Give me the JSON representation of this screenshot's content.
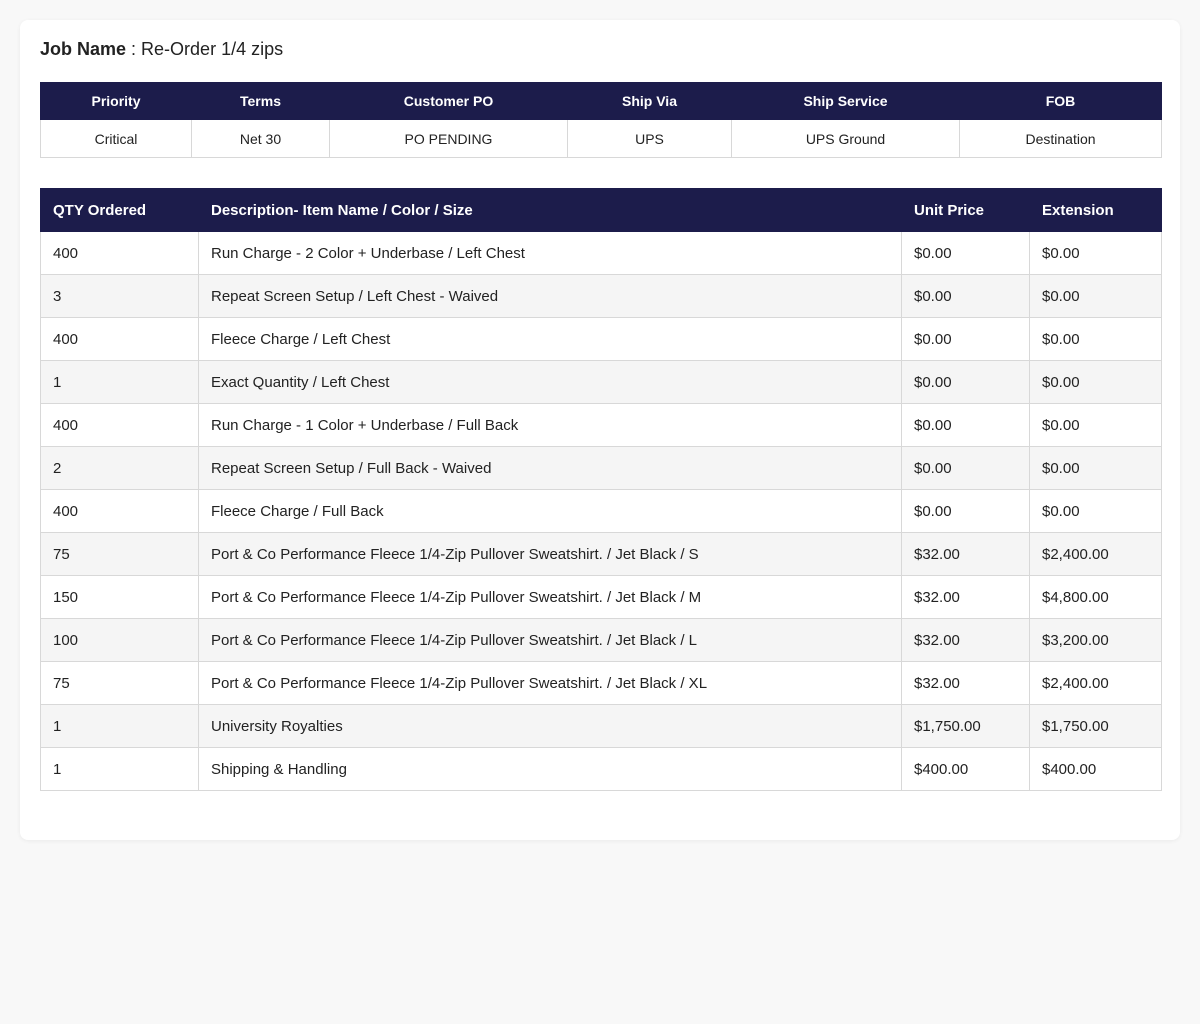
{
  "job": {
    "label": "Job Name",
    "separator": " : ",
    "value": "Re-Order 1/4 zips"
  },
  "order_info": {
    "headers": [
      "Priority",
      "Terms",
      "Customer PO",
      "Ship Via",
      "Ship Service",
      "FOB"
    ],
    "values": [
      "Critical",
      "Net 30",
      "PO PENDING",
      "UPS",
      "UPS Ground",
      "Destination"
    ]
  },
  "line_items": {
    "headers": [
      "QTY Ordered",
      "Description- Item Name / Color / Size",
      "Unit Price",
      "Extension"
    ],
    "rows": [
      {
        "qty": "400",
        "description": "Run Charge - 2 Color + Underbase / Left Chest",
        "unit_price": "$0.00",
        "extension": "$0.00"
      },
      {
        "qty": "3",
        "description": "Repeat Screen Setup / Left Chest - Waived",
        "unit_price": "$0.00",
        "extension": "$0.00"
      },
      {
        "qty": "400",
        "description": "Fleece Charge / Left Chest",
        "unit_price": "$0.00",
        "extension": "$0.00"
      },
      {
        "qty": "1",
        "description": "Exact Quantity / Left Chest",
        "unit_price": "$0.00",
        "extension": "$0.00"
      },
      {
        "qty": "400",
        "description": "Run Charge - 1 Color + Underbase / Full Back",
        "unit_price": "$0.00",
        "extension": "$0.00"
      },
      {
        "qty": "2",
        "description": "Repeat Screen Setup / Full Back - Waived",
        "unit_price": "$0.00",
        "extension": "$0.00"
      },
      {
        "qty": "400",
        "description": "Fleece Charge / Full Back",
        "unit_price": "$0.00",
        "extension": "$0.00"
      },
      {
        "qty": "75",
        "description": "Port & Co Performance Fleece 1/4-Zip Pullover Sweatshirt. / Jet Black / S",
        "unit_price": "$32.00",
        "extension": "$2,400.00"
      },
      {
        "qty": "150",
        "description": "Port & Co Performance Fleece 1/4-Zip Pullover Sweatshirt. / Jet Black / M",
        "unit_price": "$32.00",
        "extension": "$4,800.00"
      },
      {
        "qty": "100",
        "description": "Port & Co Performance Fleece 1/4-Zip Pullover Sweatshirt. / Jet Black / L",
        "unit_price": "$32.00",
        "extension": "$3,200.00"
      },
      {
        "qty": "75",
        "description": "Port & Co Performance Fleece 1/4-Zip Pullover Sweatshirt. / Jet Black / XL",
        "unit_price": "$32.00",
        "extension": "$2,400.00"
      },
      {
        "qty": "1",
        "description": "University Royalties",
        "unit_price": "$1,750.00",
        "extension": "$1,750.00"
      },
      {
        "qty": "1",
        "description": "Shipping & Handling",
        "unit_price": "$400.00",
        "extension": "$400.00"
      }
    ]
  },
  "colors": {
    "header_bg": "#1c1c4b",
    "header_text": "#ffffff",
    "row_stripe": "#f5f5f5",
    "border": "#d8d8d8",
    "page_bg": "#f8f8f8"
  }
}
